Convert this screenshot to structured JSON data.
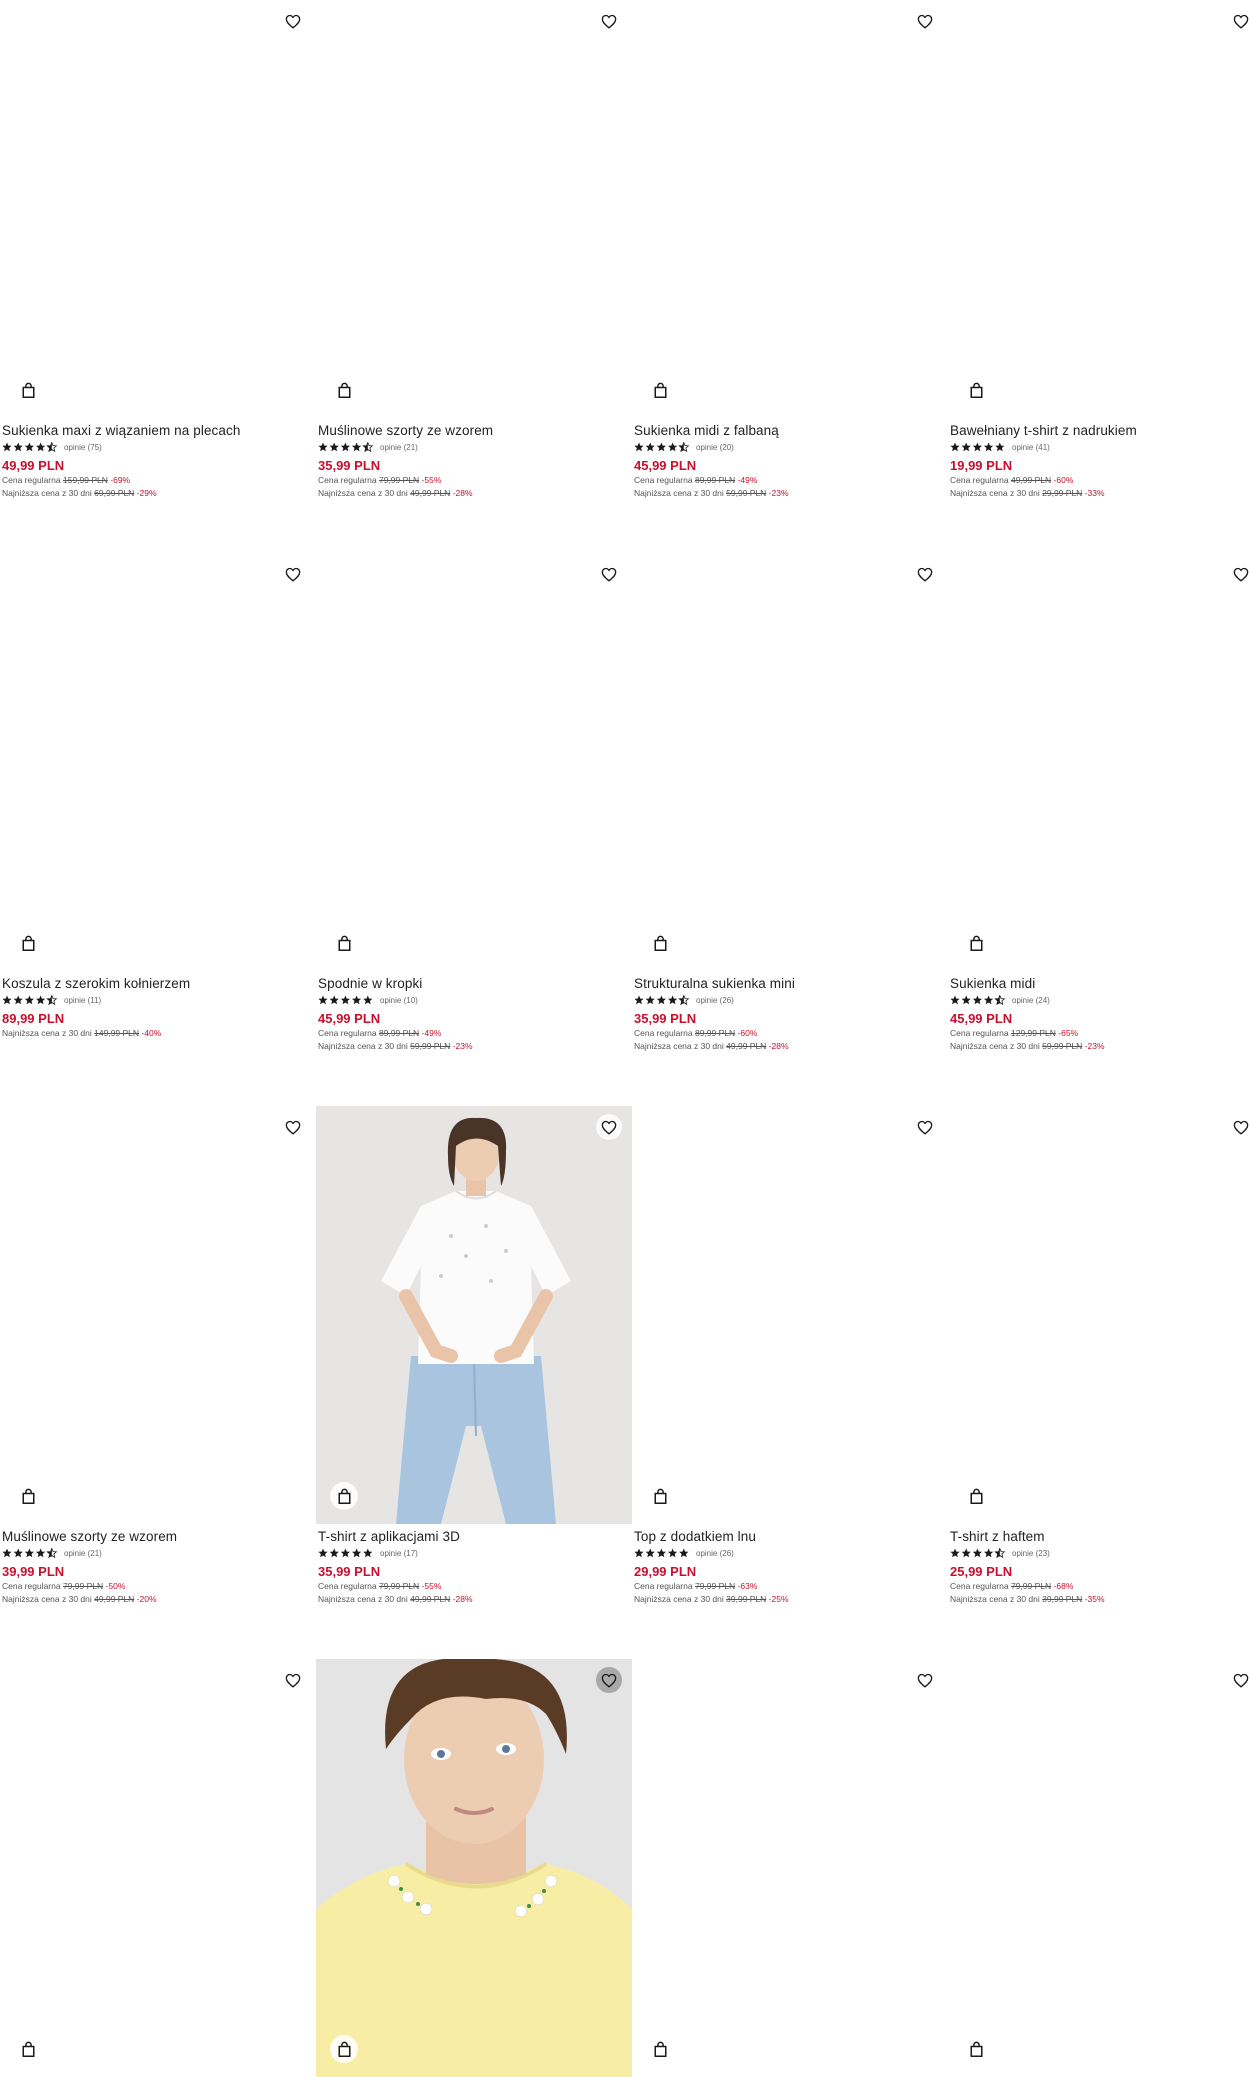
{
  "accent_color": "#c8102e",
  "products": [
    {
      "name": "Sukienka maxi z wiązaniem na plecach",
      "rating": 4.5,
      "reviews": "opinie (75)",
      "price": "49,99 PLN",
      "regular_label": "Cena regularna",
      "regular_price": "159,99 PLN",
      "regular_discount": "-69%",
      "lowest_label": "Najniższa cena z 30 dni",
      "lowest_price": "69,99 PLN",
      "lowest_discount": "-29%",
      "image": "blank"
    },
    {
      "name": "Muślinowe szorty ze wzorem",
      "rating": 4.5,
      "reviews": "opinie (21)",
      "price": "35,99 PLN",
      "regular_label": "Cena regularna",
      "regular_price": "79,99 PLN",
      "regular_discount": "-55%",
      "lowest_label": "Najniższa cena z 30 dni",
      "lowest_price": "49,99 PLN",
      "lowest_discount": "-28%",
      "image": "blank"
    },
    {
      "name": "Sukienka midi z falbaną",
      "rating": 4.5,
      "reviews": "opinie (20)",
      "price": "45,99 PLN",
      "regular_label": "Cena regularna",
      "regular_price": "89,99 PLN",
      "regular_discount": "-49%",
      "lowest_label": "Najniższa cena z 30 dni",
      "lowest_price": "59,99 PLN",
      "lowest_discount": "-23%",
      "image": "blank"
    },
    {
      "name": "Bawełniany t-shirt z nadrukiem",
      "rating": 5,
      "reviews": "opinie (41)",
      "price": "19,99 PLN",
      "regular_label": "Cena regularna",
      "regular_price": "49,99 PLN",
      "regular_discount": "-60%",
      "lowest_label": "Najniższa cena z 30 dni",
      "lowest_price": "29,99 PLN",
      "lowest_discount": "-33%",
      "image": "blank"
    },
    {
      "name": "Koszula z szerokim kołnierzem",
      "rating": 4.5,
      "reviews": "opinie (11)",
      "price": "89,99 PLN",
      "lowest_label": "Najniższa cena z 30 dni",
      "lowest_price": "149,99 PLN",
      "lowest_discount": "-40%",
      "image": "blank"
    },
    {
      "name": "Spodnie w kropki",
      "rating": 5,
      "reviews": "opinie (10)",
      "price": "45,99 PLN",
      "regular_label": "Cena regularna",
      "regular_price": "89,99 PLN",
      "regular_discount": "-49%",
      "lowest_label": "Najniższa cena z 30 dni",
      "lowest_price": "59,99 PLN",
      "lowest_discount": "-23%",
      "image": "blank"
    },
    {
      "name": "Strukturalna sukienka mini",
      "rating": 4.5,
      "reviews": "opinie (26)",
      "price": "35,99 PLN",
      "regular_label": "Cena regularna",
      "regular_price": "89,99 PLN",
      "regular_discount": "-60%",
      "lowest_label": "Najniższa cena z 30 dni",
      "lowest_price": "49,99 PLN",
      "lowest_discount": "-28%",
      "image": "blank"
    },
    {
      "name": "Sukienka midi",
      "rating": 4.5,
      "reviews": "opinie (24)",
      "price": "45,99 PLN",
      "regular_label": "Cena regularna",
      "regular_price": "129,99 PLN",
      "regular_discount": "-65%",
      "lowest_label": "Najniższa cena z 30 dni",
      "lowest_price": "59,99 PLN",
      "lowest_discount": "-23%",
      "image": "blank"
    },
    {
      "name": "Muślinowe szorty ze wzorem",
      "rating": 4.5,
      "reviews": "opinie (21)",
      "price": "39,99 PLN",
      "regular_label": "Cena regularna",
      "regular_price": "79,99 PLN",
      "regular_discount": "-50%",
      "lowest_label": "Najniższa cena z 30 dni",
      "lowest_price": "49,99 PLN",
      "lowest_discount": "-20%",
      "image": "blank"
    },
    {
      "name": "T-shirt z aplikacjami 3D",
      "rating": 5,
      "reviews": "opinie (17)",
      "price": "35,99 PLN",
      "regular_label": "Cena regularna",
      "regular_price": "79,99 PLN",
      "regular_discount": "-55%",
      "lowest_label": "Najniższa cena z 30 dni",
      "lowest_price": "49,99 PLN",
      "lowest_discount": "-28%",
      "image": "white-tshirt-photo"
    },
    {
      "name": "Top z dodatkiem lnu",
      "rating": 5,
      "reviews": "opinie (26)",
      "price": "29,99 PLN",
      "regular_label": "Cena regularna",
      "regular_price": "79,99 PLN",
      "regular_discount": "-63%",
      "lowest_label": "Najniższa cena z 30 dni",
      "lowest_price": "39,99 PLN",
      "lowest_discount": "-25%",
      "image": "blank"
    },
    {
      "name": "T-shirt z haftem",
      "rating": 4.5,
      "reviews": "opinie (23)",
      "price": "25,99 PLN",
      "regular_label": "Cena regularna",
      "regular_price": "79,99 PLN",
      "regular_discount": "-68%",
      "lowest_label": "Najniższa cena z 30 dni",
      "lowest_price": "39,99 PLN",
      "lowest_discount": "-35%",
      "image": "blank"
    },
    {
      "image": "blank"
    },
    {
      "image": "yellow-tshirt-photo"
    },
    {
      "image": "blank"
    },
    {
      "image": "blank"
    }
  ]
}
